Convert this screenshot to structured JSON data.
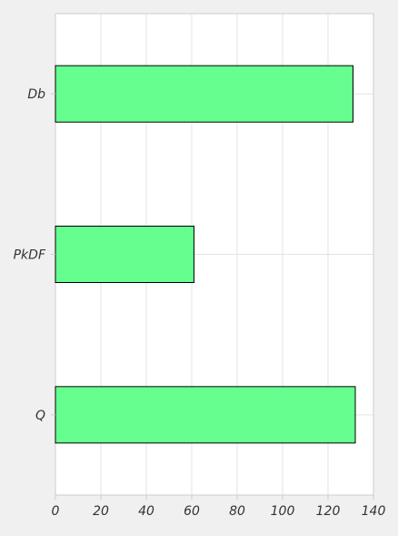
{
  "colors": {
    "background": "#f0f0f0",
    "plot_background": "#ffffff",
    "bar_fill": "#66ff8f",
    "bar_stroke": "#000000",
    "grid": "#e3e3e3",
    "text": "#333333",
    "frame": "#cccccc"
  },
  "chart_data": {
    "type": "bar",
    "orientation": "horizontal",
    "categories": [
      "Db",
      "PkDF",
      "Q"
    ],
    "values": [
      131,
      61,
      132
    ],
    "xlim": [
      0,
      140
    ],
    "x_ticks": [
      0,
      20,
      40,
      60,
      80,
      100,
      120,
      140
    ],
    "grid": true,
    "title": "",
    "xlabel": "",
    "ylabel": ""
  }
}
